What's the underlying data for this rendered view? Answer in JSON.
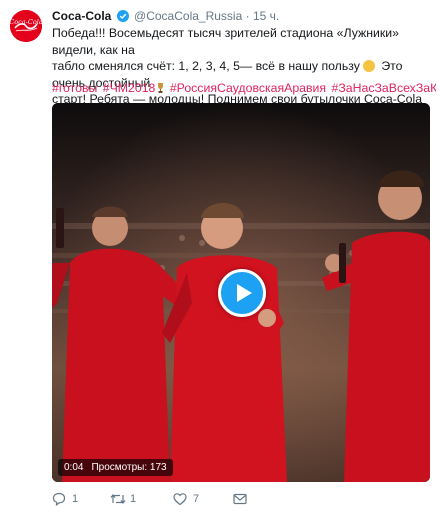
{
  "account": {
    "name": "Coca-Cola",
    "handle": "@CocaCola_Russia",
    "separator": "·",
    "time": "15 ч.",
    "avatar_text": "Coca-Cola"
  },
  "tweet": {
    "line1": "Победа!!! Восемьдесят тысяч зрителей стадиона «Лужники» видели, как на",
    "line2a": "табло сменялся счёт: 1, 2, 3, 4, 5— всё в нашу пользу",
    "line2b": " Это очень достойный",
    "line3": "старт! Ребята — молодцы! Поднимем свои бутылочки Coca-Cola за победу!",
    "emoji": "smiling-face-emoji",
    "hashtags": [
      "#готовы",
      "#ЧМ2018",
      "#РоссияСаудовскаяАравия",
      "#ЗаНасЗаВсехЗаКаждого"
    ],
    "hashtag_emoji": "trophy-emoji"
  },
  "media": {
    "duration": "0:04",
    "views_label": "Просмотры:",
    "views_count": "173",
    "play_icon": "play-icon"
  },
  "actions": {
    "replies": "1",
    "retweets": "1",
    "likes": "7",
    "reply_icon": "reply-icon",
    "retweet_icon": "retweet-icon",
    "like_icon": "heart-icon",
    "dm_icon": "envelope-icon"
  },
  "colors": {
    "link": "#e0245e",
    "brand_red": "#e4001b",
    "play_blue": "#1da1f2",
    "muted": "#657786"
  }
}
